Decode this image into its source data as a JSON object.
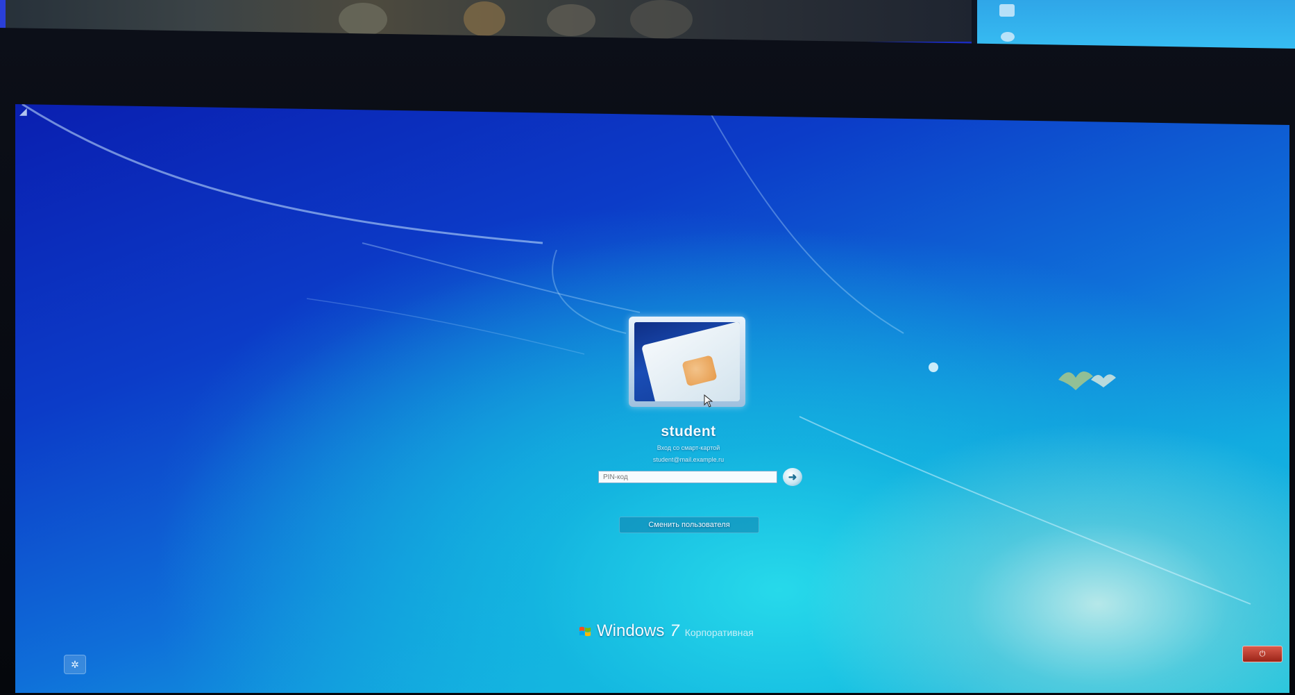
{
  "login_screen": {
    "user_name": "student",
    "subtitle_line1": "Вход со смарт-картой",
    "subtitle_line2": "student@mail.example.ru",
    "pin_placeholder": "PIN-код",
    "switch_user_label": "Сменить пользователя"
  },
  "branding": {
    "windows": "Windows",
    "version": "7",
    "edition": "Корпоративная"
  },
  "icons": {
    "user_tile": "smart-card-icon",
    "submit": "arrow-right-icon",
    "ease_of_access": "ease-of-access-icon",
    "shutdown": "power-icon",
    "cursor": "mouse-pointer-icon",
    "windows_logo": "windows-flag-icon"
  },
  "colors": {
    "background_top": "#0a1fb0",
    "background_glow": "#28dcea",
    "shutdown_red": "#c8423a",
    "frame_blue": "#2a3fd8"
  }
}
